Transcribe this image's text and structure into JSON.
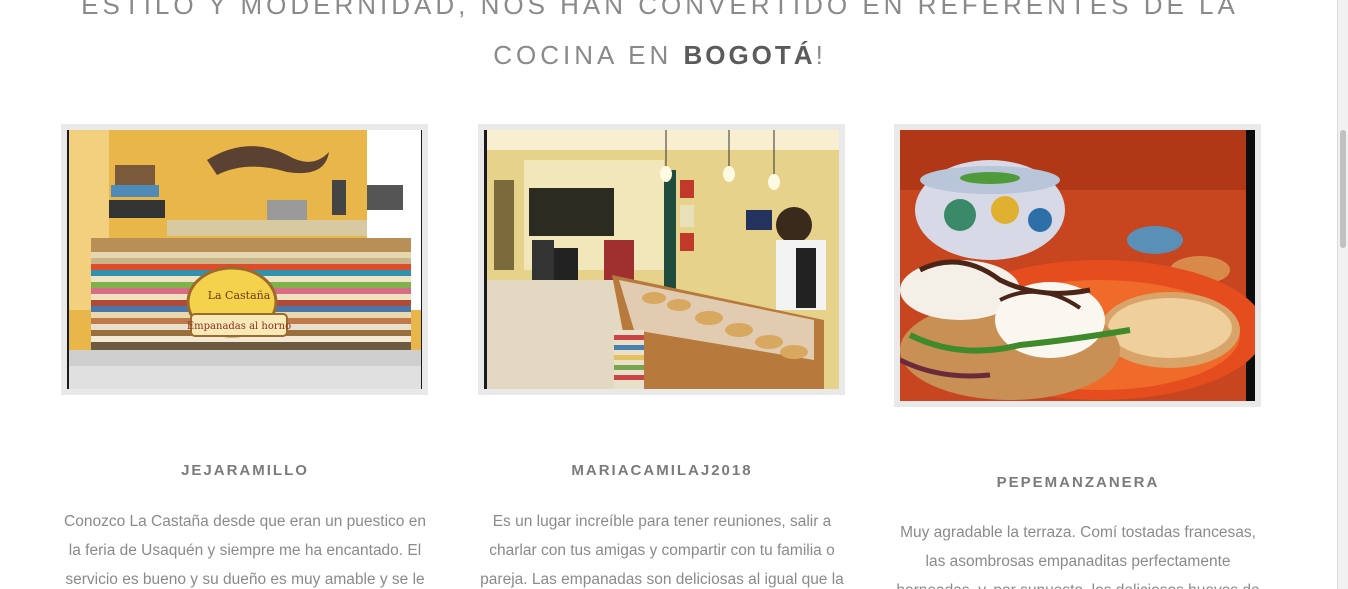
{
  "heading": {
    "line1": "ESTILO Y MODERNIDAD, NOS HAN CONVERTIDO EN REFERENTES DE LA",
    "line2_prefix": "COCINA EN ",
    "line2_bold": "BOGOTÁ",
    "line2_suffix": "!"
  },
  "reviews": [
    {
      "name": "JEJARAMILLO",
      "text": "Conozco La Castaña desde que eran un puestico en la feria de Usaquén y siempre me ha encantado. El servicio es bueno y su dueño es muy amable y se le",
      "photo_icon": "photo-counter-icon",
      "sign_text_1": "La Castaña",
      "sign_text_2": "Empanadas al horno"
    },
    {
      "name": "MARIACAMILAJ2018",
      "text": "Es un lugar increíble para tener reuniones, salir a charlar con tus amigas y compartir con tu familia o pareja. Las empanadas son deliciosas al igual que la",
      "photo_icon": "photo-interior-icon"
    },
    {
      "name": "PEPEMANZANERA",
      "text": "Muy agradable la terraza. Comí tostadas francesas, las asombrosas empanaditas perfectamente horneadas, y, por supuesto, los deliciosos huevos de",
      "photo_icon": "photo-dish-icon"
    }
  ],
  "colors": {
    "heading": "#8a8a8a",
    "heading_bold": "#5b5b5b",
    "name": "#7b7b7b",
    "text": "#8a8a8a",
    "frame": "#e9e9e9"
  }
}
